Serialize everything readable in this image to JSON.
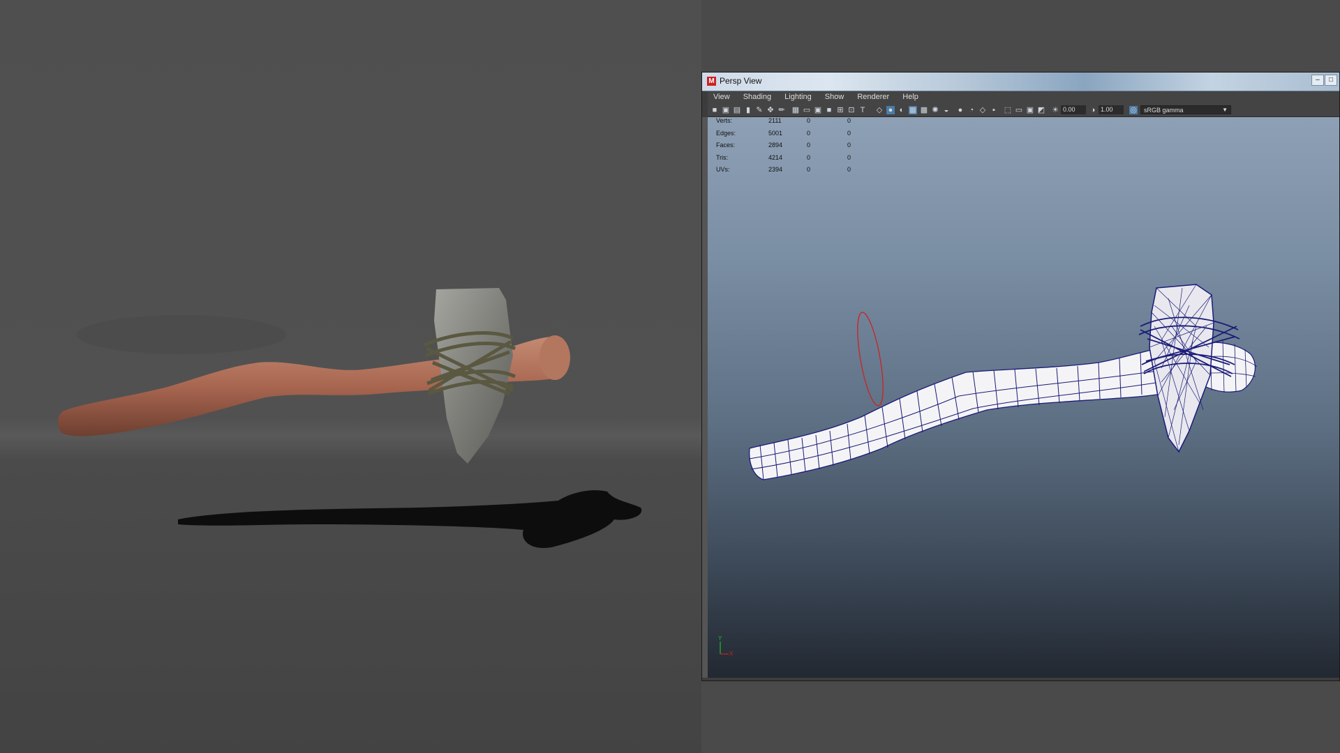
{
  "window": {
    "title": "Persp View",
    "logo_letter": "M"
  },
  "menu": [
    "View",
    "Shading",
    "Lighting",
    "Show",
    "Renderer",
    "Help"
  ],
  "toolbar": {
    "exposure": "0.00",
    "gamma": "1.00",
    "color_space": "sRGB gamma"
  },
  "hud": {
    "rows": [
      {
        "label": "Verts:",
        "value": "2111",
        "c2": "0",
        "c3": "0"
      },
      {
        "label": "Edges:",
        "value": "5001",
        "c2": "0",
        "c3": "0"
      },
      {
        "label": "Faces:",
        "value": "2894",
        "c2": "0",
        "c3": "0"
      },
      {
        "label": "Tris:",
        "value": "4214",
        "c2": "0",
        "c3": "0"
      },
      {
        "label": "UVs:",
        "value": "2394",
        "c2": "0",
        "c3": "0"
      }
    ]
  },
  "axis": {
    "y": "Y",
    "x": "X"
  },
  "colors": {
    "wire": "#1a1a78",
    "handle": "#b87560",
    "stone": "#8c8c88",
    "rope": "#5a5840",
    "selection_ring": "#cc2222"
  }
}
